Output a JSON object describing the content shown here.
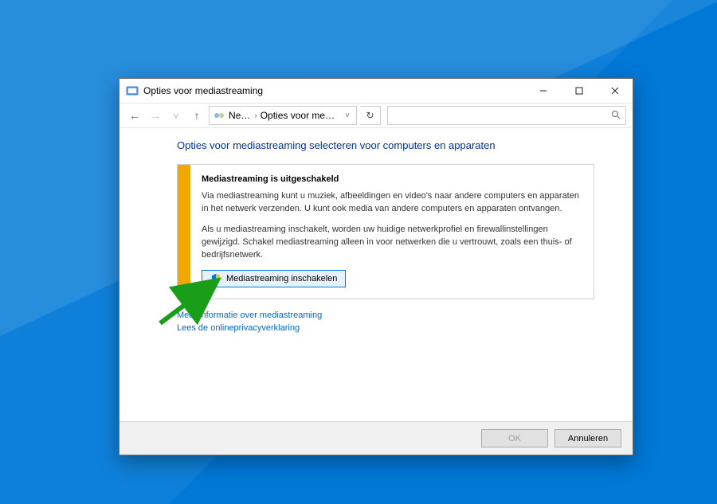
{
  "window": {
    "title": "Opties voor mediastreaming"
  },
  "nav": {
    "breadcrumb1": "Netw...",
    "breadcrumb2": "Opties voor mediastre..."
  },
  "main": {
    "heading": "Opties voor mediastreaming selecteren voor computers en apparaten",
    "panel": {
      "title": "Mediastreaming is uitgeschakeld",
      "p1": "Via mediastreaming kunt u muziek, afbeeldingen en video's naar andere computers en apparaten in het netwerk verzenden. U kunt ook media van andere computers en apparaten ontvangen.",
      "p2": "Als u mediastreaming inschakelt, worden uw huidige netwerkprofiel en firewallinstellingen gewijzigd. Schakel mediastreaming alleen in voor netwerken die u vertrouwt, zoals een thuis- of bedrijfsnetwerk.",
      "enable_button": "Mediastreaming inschakelen"
    },
    "link1": "Meer informatie over mediastreaming",
    "link2": "Lees de onlineprivacyverklaring"
  },
  "footer": {
    "ok": "OK",
    "cancel": "Annuleren"
  }
}
